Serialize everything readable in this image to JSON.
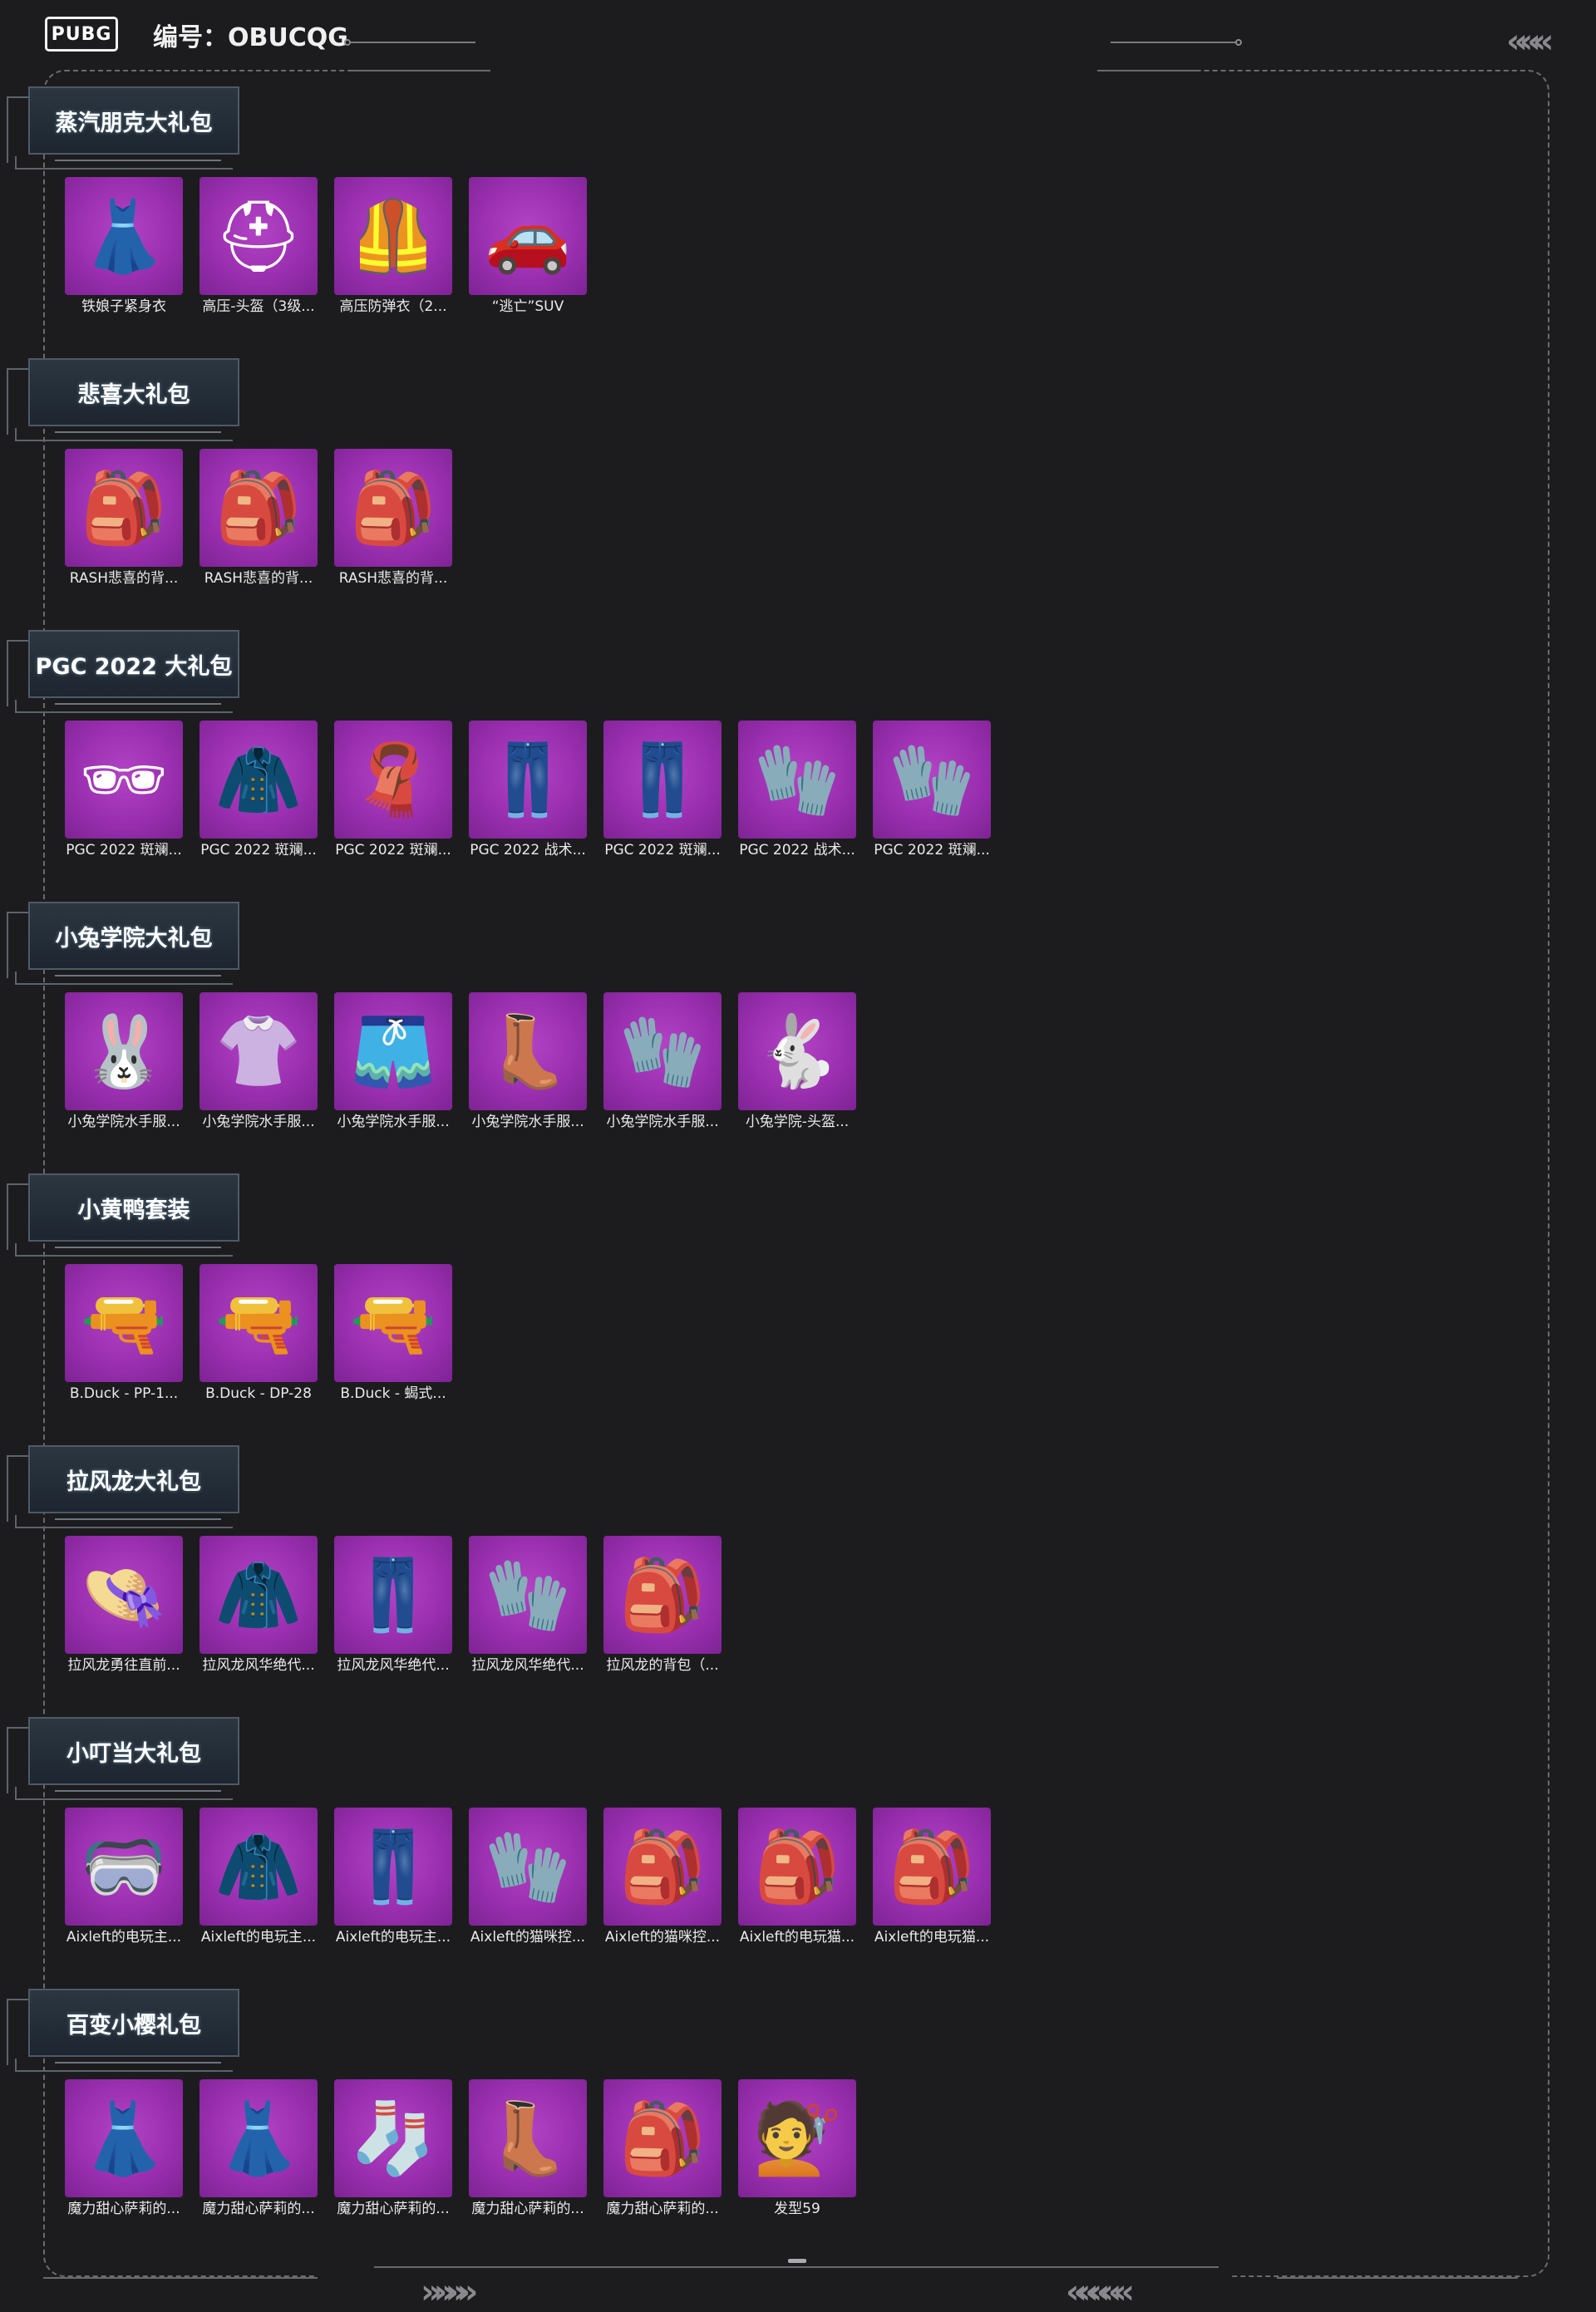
{
  "header": {
    "logo": "PUBG",
    "id_label": "编号：OBUCQG"
  },
  "sections": [
    {
      "title": "蒸汽朋克大礼包",
      "items": [
        {
          "label": "铁娘子紧身衣",
          "icon": "bodysuit-icon"
        },
        {
          "label": "高压-头盔（3级...",
          "icon": "helmet-icon"
        },
        {
          "label": "高压防弹衣（2...",
          "icon": "vest-icon"
        },
        {
          "label": "“逃亡”SUV",
          "icon": "car-icon"
        }
      ]
    },
    {
      "title": "悲喜大礼包",
      "items": [
        {
          "label": "RASH悲喜的背...",
          "icon": "backpack-icon"
        },
        {
          "label": "RASH悲喜的背...",
          "icon": "backpack-icon"
        },
        {
          "label": "RASH悲喜的背...",
          "icon": "backpack-icon"
        }
      ]
    },
    {
      "title": "PGC 2022 大礼包",
      "items": [
        {
          "label": "PGC 2022 斑斓...",
          "icon": "goggles-icon"
        },
        {
          "label": "PGC 2022 斑斓...",
          "icon": "jacket-icon"
        },
        {
          "label": "PGC 2022 斑斓...",
          "icon": "scarf-icon"
        },
        {
          "label": "PGC 2022 战术...",
          "icon": "pants-icon"
        },
        {
          "label": "PGC 2022 斑斓...",
          "icon": "pants-icon"
        },
        {
          "label": "PGC 2022 战术...",
          "icon": "gloves-icon"
        },
        {
          "label": "PGC 2022 斑斓...",
          "icon": "gloves-icon"
        }
      ]
    },
    {
      "title": "小兔学院大礼包",
      "items": [
        {
          "label": "小兔学院水手服...",
          "icon": "bunny-hat-icon"
        },
        {
          "label": "小兔学院水手服...",
          "icon": "shirt-icon"
        },
        {
          "label": "小兔学院水手服...",
          "icon": "shorts-icon"
        },
        {
          "label": "小兔学院水手服...",
          "icon": "boots-icon"
        },
        {
          "label": "小兔学院水手服...",
          "icon": "gloves-icon"
        },
        {
          "label": "小兔学院-头盔...",
          "icon": "bunny-helmet-icon"
        }
      ]
    },
    {
      "title": "小黄鸭套装",
      "items": [
        {
          "label": "B.Duck - PP-1...",
          "icon": "gun-icon"
        },
        {
          "label": "B.Duck - DP-28",
          "icon": "gun-icon"
        },
        {
          "label": "B.Duck - 蝎式...",
          "icon": "gun-icon"
        }
      ]
    },
    {
      "title": "拉风龙大礼包",
      "items": [
        {
          "label": "拉风龙勇往直前...",
          "icon": "bucket-hat-icon"
        },
        {
          "label": "拉风龙风华绝代...",
          "icon": "jacket-icon"
        },
        {
          "label": "拉风龙风华绝代...",
          "icon": "pants-icon"
        },
        {
          "label": "拉风龙风华绝代...",
          "icon": "gloves-icon"
        },
        {
          "label": "拉风龙的背包（...",
          "icon": "backpack-icon"
        }
      ]
    },
    {
      "title": "小叮当大礼包",
      "items": [
        {
          "label": "Aixleft的电玩主...",
          "icon": "visor-icon"
        },
        {
          "label": "Aixleft的电玩主...",
          "icon": "hoodie-icon"
        },
        {
          "label": "Aixleft的电玩主...",
          "icon": "pants-icon"
        },
        {
          "label": "Aixleft的猫咪控...",
          "icon": "gloves-icon"
        },
        {
          "label": "Aixleft的猫咪控...",
          "icon": "backpack-icon"
        },
        {
          "label": "Aixleft的电玩猫...",
          "icon": "backpack-icon"
        },
        {
          "label": "Aixleft的电玩猫...",
          "icon": "backpack-icon"
        }
      ]
    },
    {
      "title": "百变小樱礼包",
      "items": [
        {
          "label": "魔力甜心萨莉的...",
          "icon": "dress-icon"
        },
        {
          "label": "魔力甜心萨莉的...",
          "icon": "dress-icon"
        },
        {
          "label": "魔力甜心萨莉的...",
          "icon": "stocking-icon"
        },
        {
          "label": "魔力甜心萨莉的...",
          "icon": "boots-icon"
        },
        {
          "label": "魔力甜心萨莉的...",
          "icon": "backpack-icon"
        },
        {
          "label": "发型59",
          "icon": "hair-icon"
        }
      ]
    }
  ]
}
